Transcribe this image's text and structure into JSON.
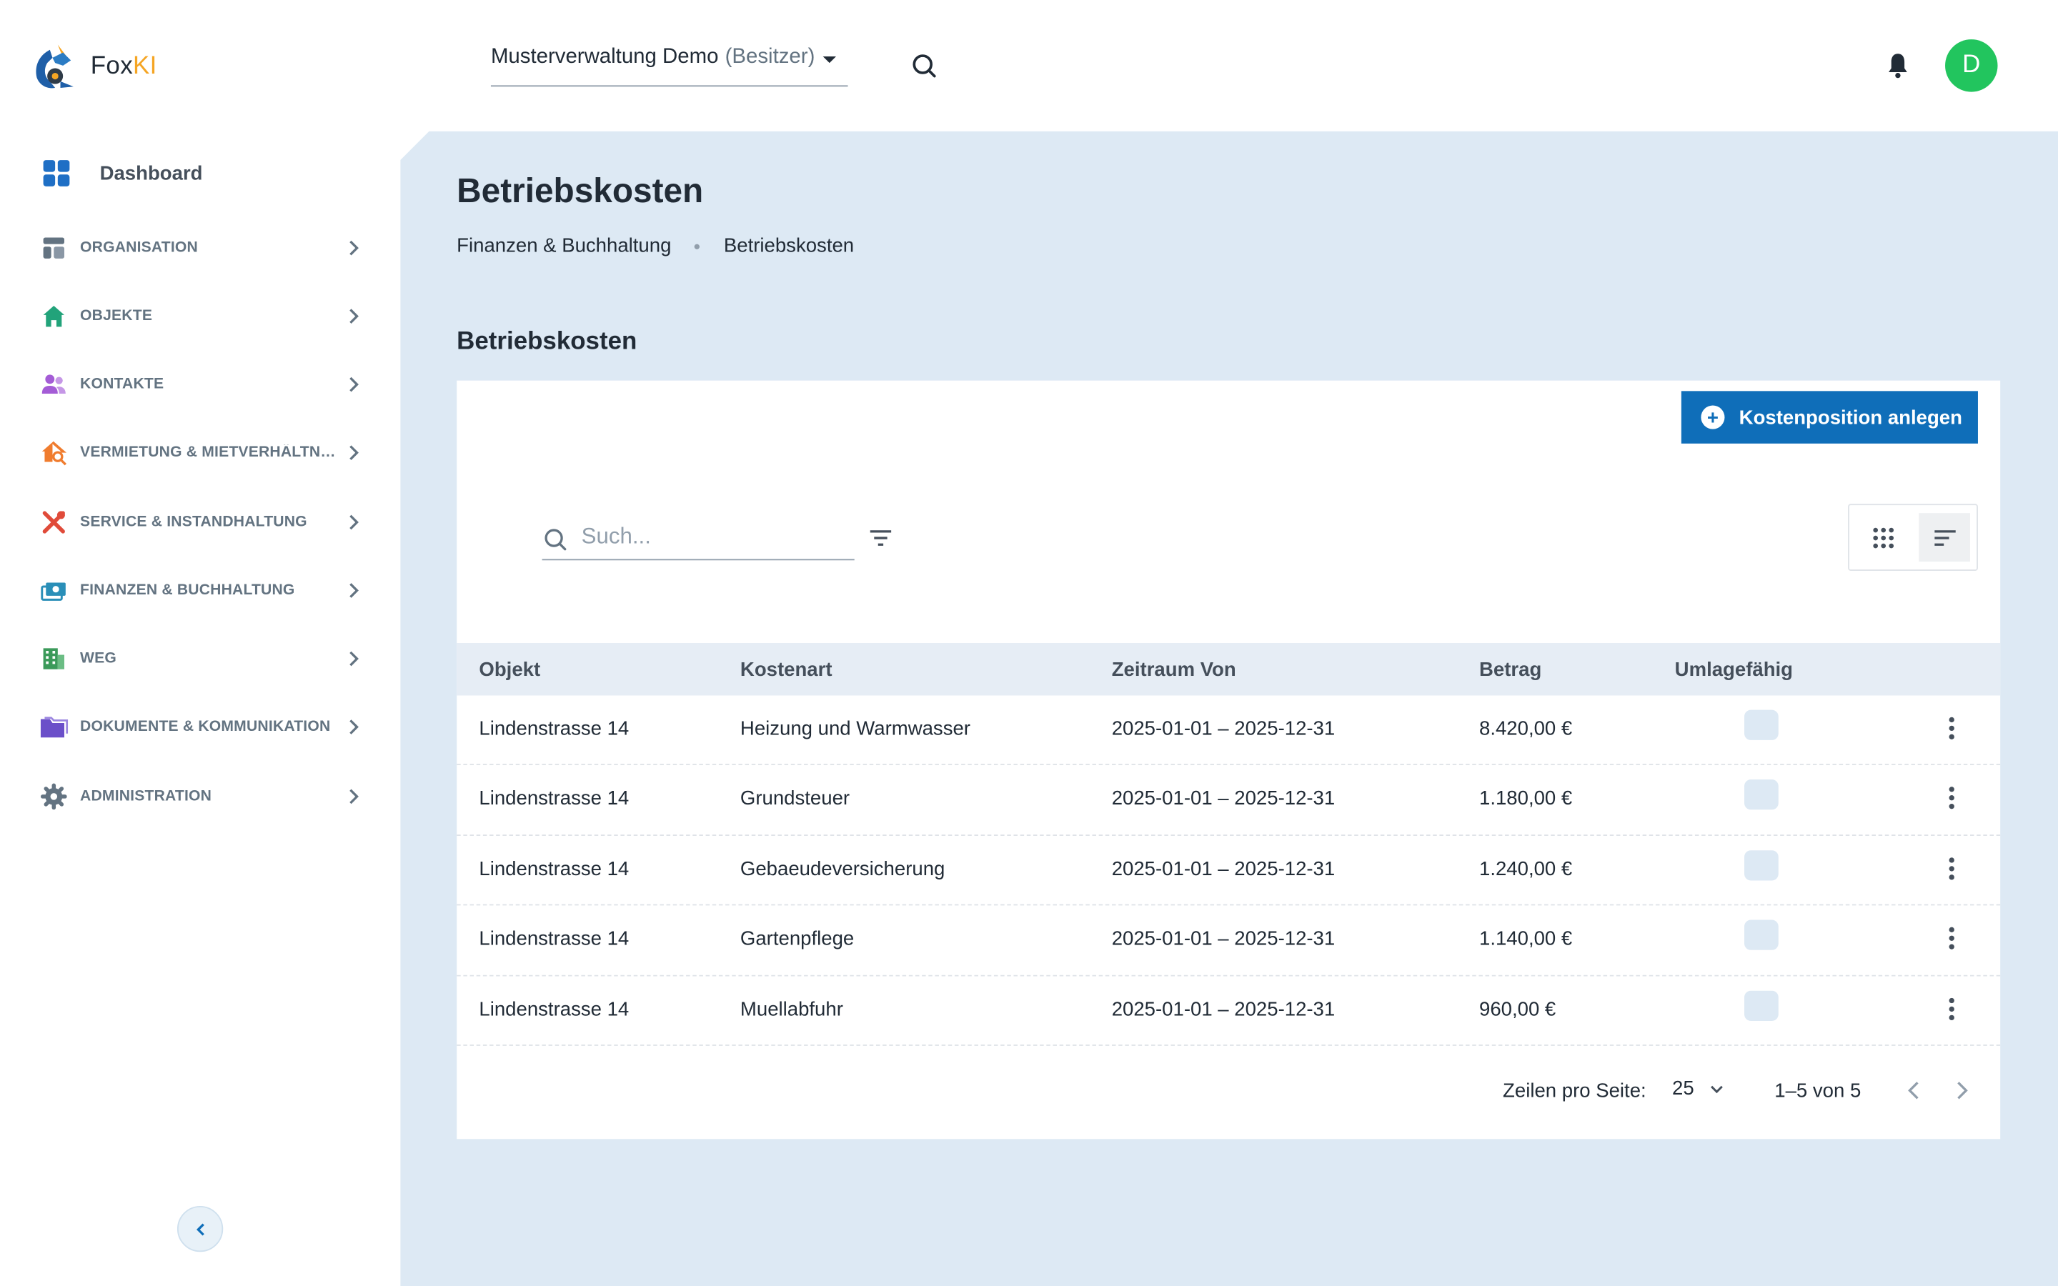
{
  "app": {
    "logo_text_main": "Fox",
    "logo_text_accent": "KI",
    "accent_color": "#0f6eb9",
    "avatar_color": "#22c55e"
  },
  "header": {
    "org_name": "Musterverwaltung Demo",
    "org_role": "(Besitzer)",
    "avatar_initial": "D"
  },
  "sidebar": {
    "dashboard_label": "Dashboard",
    "items": [
      {
        "label": "ORGANISATION",
        "icon": "layout-icon",
        "color": "#637381"
      },
      {
        "label": "OBJEKTE",
        "icon": "home-icon",
        "color": "#22a37a"
      },
      {
        "label": "KONTAKTE",
        "icon": "people-icon",
        "color": "#a45cd6"
      },
      {
        "label": "VERMIETUNG & MIETVERHÄLTNISSE",
        "icon": "house-search-icon",
        "color": "#f07c2e"
      },
      {
        "label": "SERVICE & INSTANDHALTUNG",
        "icon": "tools-icon",
        "color": "#e04b3a"
      },
      {
        "label": "FINANZEN & BUCHHALTUNG",
        "icon": "money-icon",
        "color": "#2a8fb8"
      },
      {
        "label": "WEG",
        "icon": "building-icon",
        "color": "#3b9a5a"
      },
      {
        "label": "DOKUMENTE & KOMMUNIKATION",
        "icon": "folder-icon",
        "color": "#6b4fc9"
      },
      {
        "label": "ADMINISTRATION",
        "icon": "gear-icon",
        "color": "#637381"
      }
    ]
  },
  "main": {
    "page_title": "Betriebskosten",
    "breadcrumb": [
      "Finanzen & Buchhaltung",
      "Betriebskosten"
    ],
    "section_title": "Betriebskosten",
    "add_button_label": "Kostenposition anlegen",
    "search_placeholder": "Such...",
    "table": {
      "columns": [
        "Objekt",
        "Kostenart",
        "Zeitraum Von",
        "Betrag",
        "Umlagefähig"
      ],
      "rows": [
        {
          "objekt": "Lindenstrasse 14",
          "kostenart": "Heizung und Warmwasser",
          "zeitraum": "2025-01-01 – 2025-12-31",
          "betrag": "8.420,00 €",
          "umlagefaehig": false
        },
        {
          "objekt": "Lindenstrasse 14",
          "kostenart": "Grundsteuer",
          "zeitraum": "2025-01-01 – 2025-12-31",
          "betrag": "1.180,00 €",
          "umlagefaehig": false
        },
        {
          "objekt": "Lindenstrasse 14",
          "kostenart": "Gebaeudeversicherung",
          "zeitraum": "2025-01-01 – 2025-12-31",
          "betrag": "1.240,00 €",
          "umlagefaehig": false
        },
        {
          "objekt": "Lindenstrasse 14",
          "kostenart": "Gartenpflege",
          "zeitraum": "2025-01-01 – 2025-12-31",
          "betrag": "1.140,00 €",
          "umlagefaehig": false
        },
        {
          "objekt": "Lindenstrasse 14",
          "kostenart": "Muellabfuhr",
          "zeitraum": "2025-01-01 – 2025-12-31",
          "betrag": "960,00 €",
          "umlagefaehig": false
        }
      ]
    },
    "pagination": {
      "rows_per_page_label": "Zeilen pro Seite:",
      "rows_per_page": "25",
      "range_label": "1–5 von 5"
    }
  }
}
